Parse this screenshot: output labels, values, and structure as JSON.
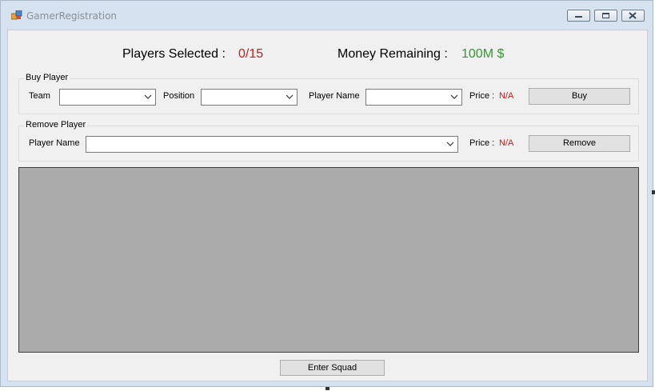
{
  "window": {
    "title": "GamerRegistration",
    "icon": "app-windows-icon",
    "controls": [
      "minimize-icon",
      "maximize-icon",
      "close-icon"
    ]
  },
  "summary": {
    "players_selected_label": "Players Selected :",
    "players_selected_value": "0/15",
    "money_remaining_label": "Money Remaining :",
    "money_remaining_value": "100M $"
  },
  "buy_player": {
    "group_title": "Buy Player",
    "team_label": "Team",
    "team_value": "",
    "position_label": "Position",
    "position_value": "",
    "player_name_label": "Player Name",
    "player_name_value": "",
    "price_label": "Price :",
    "price_value": "N/A",
    "buy_button": "Buy"
  },
  "remove_player": {
    "group_title": "Remove Player",
    "player_name_label": "Player Name",
    "player_name_value": "",
    "price_label": "Price :",
    "price_value": "N/A",
    "remove_button": "Remove"
  },
  "footer": {
    "enter_squad_button": "Enter Squad"
  },
  "colors": {
    "accent_red": "#c0201f",
    "money_green": "#2e9b2e",
    "grid_background": "#ababab",
    "form_background": "#f0f0f0"
  }
}
